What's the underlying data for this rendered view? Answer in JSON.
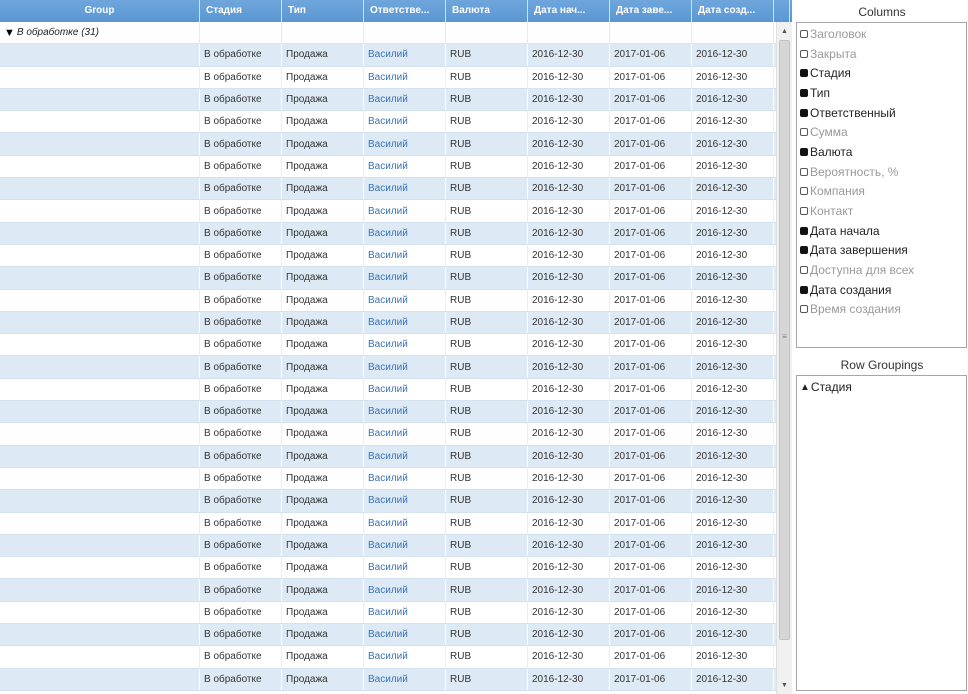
{
  "grid": {
    "columns": [
      "Group",
      "Стадия",
      "Тип",
      "Ответстве...",
      "Валюта",
      "Дата нач...",
      "Дата заве...",
      "Дата созд..."
    ],
    "group": {
      "label": "В обработке (31)",
      "expanded": true
    },
    "row_template": {
      "stage": "В обработке",
      "type": "Продажа",
      "owner": "Василий",
      "currency": "RUB",
      "start_date": "2016-12-30",
      "end_date": "2017-01-06",
      "created_date": "2016-12-30"
    },
    "visible_row_count": 29,
    "colors": {
      "header": "#5a97d3",
      "stripe": "#ddeaf6",
      "link": "#3a72b5"
    }
  },
  "columns_panel": {
    "title": "Columns",
    "items": [
      {
        "label": "Заголовок",
        "checked": false
      },
      {
        "label": "Закрыта",
        "checked": false
      },
      {
        "label": "Стадия",
        "checked": true
      },
      {
        "label": "Тип",
        "checked": true
      },
      {
        "label": "Ответственный",
        "checked": true
      },
      {
        "label": "Сумма",
        "checked": false
      },
      {
        "label": "Валюта",
        "checked": true
      },
      {
        "label": "Вероятность, %",
        "checked": false
      },
      {
        "label": "Компания",
        "checked": false
      },
      {
        "label": "Контакт",
        "checked": false
      },
      {
        "label": "Дата начала",
        "checked": true
      },
      {
        "label": "Дата завершения",
        "checked": true
      },
      {
        "label": "Доступна для всех",
        "checked": false
      },
      {
        "label": "Дата создания",
        "checked": true
      },
      {
        "label": "Время создания",
        "checked": false
      }
    ]
  },
  "groupings_panel": {
    "title": "Row Groupings",
    "items": [
      {
        "label": "Стадия",
        "direction": "ascending"
      }
    ]
  },
  "icons": {
    "expand": "triangle-down-icon",
    "sort": "triangle-up-icon",
    "scroll_up": "arrow-up-icon",
    "scroll_down": "arrow-down-icon"
  }
}
